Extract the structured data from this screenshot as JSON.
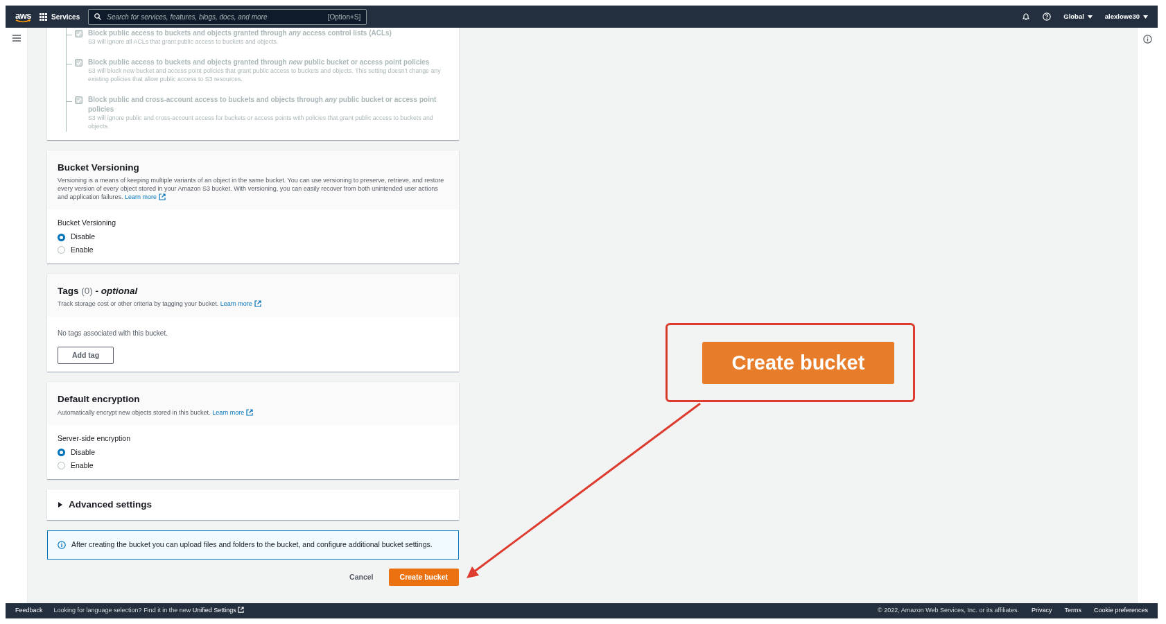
{
  "top_bar": {
    "logo": "aws",
    "services_label": "Services",
    "search": {
      "placeholder": "Search for services, features, blogs, docs, and more",
      "shortcut": "[Option+S]"
    },
    "region": "Global",
    "account": "alexlowe30"
  },
  "block_public_access": {
    "options": [
      {
        "title": "Block public access to buckets and objects granted through *any* access control lists (ACLs)",
        "description": "S3 will ignore all ACLs that grant public access to buckets and objects.",
        "checked": true,
        "disabled": true
      },
      {
        "title": "Block public access to buckets and objects granted through *new* public bucket or access point policies",
        "description": "S3 will block new bucket and access point policies that grant public access to buckets and objects. This setting doesn't change any existing policies that allow public access to S3 resources.",
        "checked": true,
        "disabled": true
      },
      {
        "title": "Block public and cross-account access to buckets and objects through *any* public bucket or access point policies",
        "description": "S3 will ignore public and cross-account access for buckets or access points with policies that grant public access to buckets and objects.",
        "checked": true,
        "disabled": true
      }
    ]
  },
  "bucket_versioning": {
    "title": "Bucket Versioning",
    "description": "Versioning is a means of keeping multiple variants of an object in the same bucket. You can use versioning to preserve, retrieve, and restore every version of every object stored in your Amazon S3 bucket. With versioning, you can easily recover from both unintended user actions and application failures.",
    "learn_more": "Learn more",
    "field_label": "Bucket Versioning",
    "options": [
      {
        "label": "Disable",
        "selected": true
      },
      {
        "label": "Enable",
        "selected": false
      }
    ]
  },
  "tags": {
    "title": "Tags",
    "count": "(0)",
    "qualifier": "- optional",
    "description": "Track storage cost or other criteria by tagging your bucket.",
    "learn_more": "Learn more",
    "empty_text": "No tags associated with this bucket.",
    "add_button": "Add tag"
  },
  "default_encryption": {
    "title": "Default encryption",
    "description": "Automatically encrypt new objects stored in this bucket.",
    "learn_more": "Learn more",
    "field_label": "Server-side encryption",
    "options": [
      {
        "label": "Disable",
        "selected": true
      },
      {
        "label": "Enable",
        "selected": false
      }
    ]
  },
  "advanced_settings": {
    "label": "Advanced settings",
    "expanded": false
  },
  "info_alert": "After creating the bucket you can upload files and folders to the bucket, and configure additional bucket settings.",
  "actions": {
    "cancel": "Cancel",
    "create": "Create bucket"
  },
  "callout": {
    "button": "Create bucket"
  },
  "footer": {
    "feedback": "Feedback",
    "language_note": "Looking for language selection? Find it in the new",
    "settings_link": "Unified Settings",
    "copyright": "© 2022, Amazon Web Services, Inc. or its affiliates.",
    "links": [
      "Privacy",
      "Terms",
      "Cookie preferences"
    ]
  }
}
